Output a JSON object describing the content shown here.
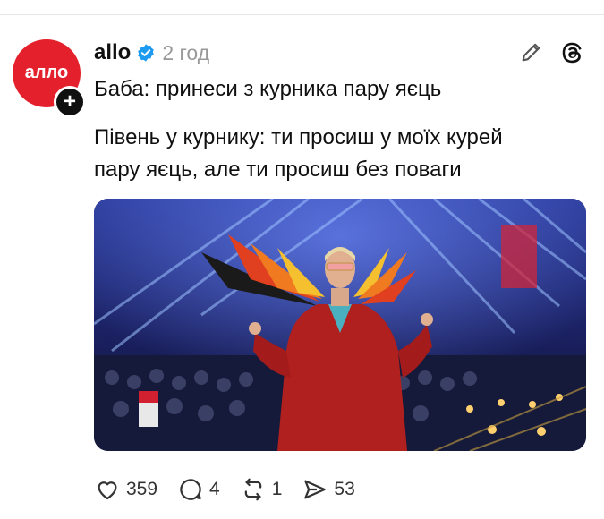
{
  "post": {
    "username": "allo",
    "time": "2 год",
    "avatar_text": "алло",
    "follow_symbol": "+",
    "text_line1": "Баба: принеси з курника пару яєць",
    "text_line2": "Півень у курнику: ти просиш у моїх курей",
    "text_line3": "пару яєць, але ти просиш без поваги"
  },
  "actions": {
    "likes": "359",
    "replies": "4",
    "reposts": "1",
    "shares": "53"
  },
  "colors": {
    "brand_red": "#e3202b",
    "verified_blue": "#1d9bf0"
  },
  "icons": [
    "pencil-icon",
    "threads-logo-icon",
    "heart-icon",
    "comment-icon",
    "repost-icon",
    "share-icon",
    "verified-badge-icon"
  ]
}
